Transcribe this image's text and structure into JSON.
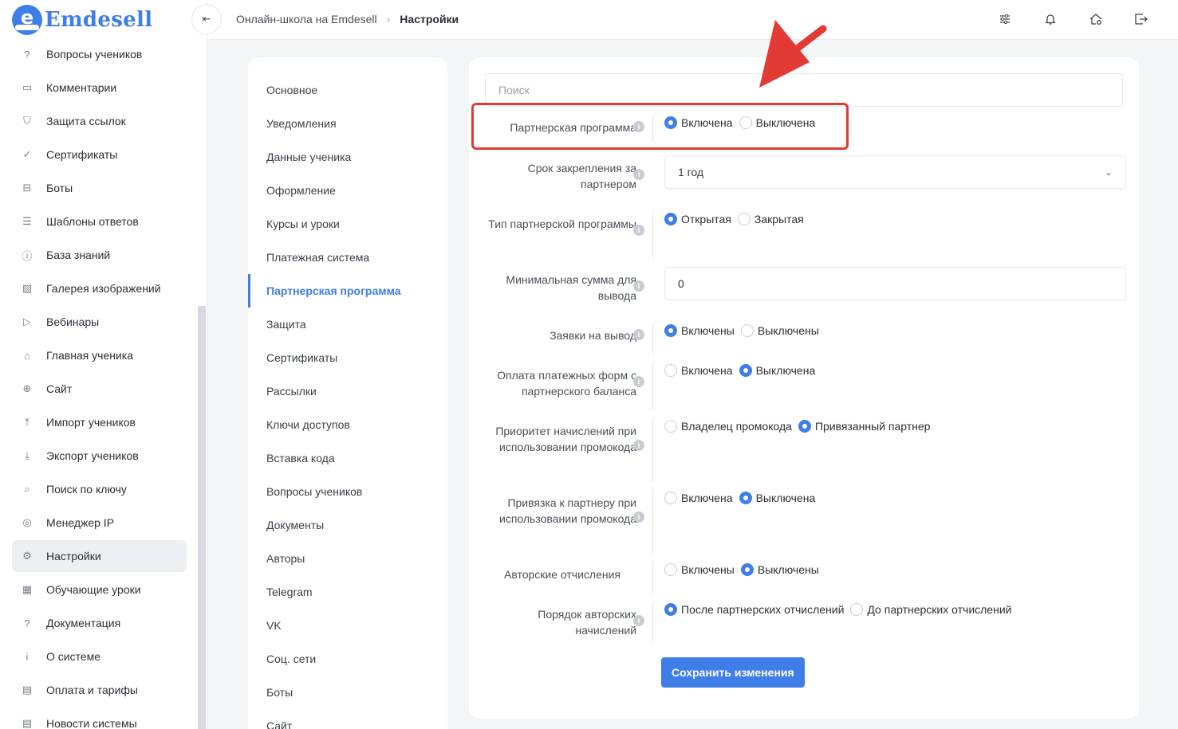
{
  "app": {
    "brand": "Emdesell",
    "accent_color": "#3f7ee8",
    "highlight_color": "#e23b36"
  },
  "sidebar": {
    "items": [
      {
        "label": "Вопросы учеников",
        "icon": "question-circle-icon",
        "glyph": "?"
      },
      {
        "label": "Комментарии",
        "icon": "comment-icon",
        "glyph": "▭"
      },
      {
        "label": "Защита ссылок",
        "icon": "shield-icon",
        "glyph": "⛉"
      },
      {
        "label": "Сертификаты",
        "icon": "certificate-icon",
        "glyph": "✓"
      },
      {
        "label": "Боты",
        "icon": "robot-icon",
        "glyph": "⊟"
      },
      {
        "label": "Шаблоны ответов",
        "icon": "list-icon",
        "glyph": "☰"
      },
      {
        "label": "База знаний",
        "icon": "info-circle-icon",
        "glyph": "ⓘ"
      },
      {
        "label": "Галерея изображений",
        "icon": "image-icon",
        "glyph": "▨"
      },
      {
        "label": "Вебинары",
        "icon": "play-icon",
        "glyph": "▷"
      },
      {
        "label": "Главная ученика",
        "icon": "home-icon",
        "glyph": "⌂"
      },
      {
        "label": "Сайт",
        "icon": "globe-icon",
        "glyph": "⊕"
      },
      {
        "label": "Импорт учеников",
        "icon": "upload-icon",
        "glyph": "⤒"
      },
      {
        "label": "Экспорт учеников",
        "icon": "download-icon",
        "glyph": "⤓"
      },
      {
        "label": "Поиск по ключу",
        "icon": "search-icon",
        "glyph": "⌕"
      },
      {
        "label": "Менеджер IP",
        "icon": "target-icon",
        "glyph": "◎"
      },
      {
        "label": "Настройки",
        "icon": "gear-icon",
        "glyph": "⚙",
        "active": true
      },
      {
        "label": "Обучающие уроки",
        "icon": "film-icon",
        "glyph": "▦"
      },
      {
        "label": "Документация",
        "icon": "question-square-icon",
        "glyph": "?"
      },
      {
        "label": "О системе",
        "icon": "info-square-icon",
        "glyph": "i"
      },
      {
        "label": "Оплата и тарифы",
        "icon": "receipt-icon",
        "glyph": "▤"
      },
      {
        "label": "Новости системы",
        "icon": "news-icon",
        "glyph": "▤"
      }
    ]
  },
  "topbar": {
    "breadcrumb": [
      "Онлайн-школа на Emdesell",
      "Настройки"
    ],
    "icons": [
      "sliders-icon",
      "bell-icon",
      "home-settings-icon",
      "logout-icon"
    ]
  },
  "settings_menu": {
    "items": [
      {
        "label": "Основное"
      },
      {
        "label": "Уведомления"
      },
      {
        "label": "Данные ученика"
      },
      {
        "label": "Оформление"
      },
      {
        "label": "Курсы и уроки"
      },
      {
        "label": "Платежная система"
      },
      {
        "label": "Партнерская программа",
        "active": true
      },
      {
        "label": "Защита"
      },
      {
        "label": "Сертификаты"
      },
      {
        "label": "Рассылки"
      },
      {
        "label": "Ключи доступов"
      },
      {
        "label": "Вставка кода"
      },
      {
        "label": "Вопросы учеников"
      },
      {
        "label": "Документы"
      },
      {
        "label": "Авторы"
      },
      {
        "label": "Telegram"
      },
      {
        "label": "VK"
      },
      {
        "label": "Соц. сети"
      },
      {
        "label": "Боты"
      },
      {
        "label": "Сайт"
      }
    ]
  },
  "form": {
    "search_placeholder": "Поиск",
    "affiliate_program": {
      "label": "Партнерская программа",
      "options": [
        "Включена",
        "Выключена"
      ],
      "selected": 0
    },
    "binding_period": {
      "label": "Срок закрепления за партнером",
      "value": "1 год"
    },
    "program_type": {
      "label": "Тип партнерской программы",
      "options": [
        "Открытая",
        "Закрытая"
      ],
      "selected": 0
    },
    "min_withdraw": {
      "label": "Минимальная сумма для вывода",
      "value": "0"
    },
    "withdraw_requests": {
      "label": "Заявки на вывод",
      "options": [
        "Включены",
        "Выключены"
      ],
      "selected": 0
    },
    "pay_from_balance": {
      "label": "Оплата платежных форм с партнерского баланса",
      "options": [
        "Включена",
        "Выключена"
      ],
      "selected": 1
    },
    "promo_priority": {
      "label": "Приоритет начислений при использовании промокода",
      "options": [
        "Владелец промокода",
        "Привязанный партнер"
      ],
      "selected": 1
    },
    "promo_binding": {
      "label": "Привязка к партнеру при использовании промокода",
      "options": [
        "Включена",
        "Выключена"
      ],
      "selected": 1
    },
    "author_fees": {
      "label": "Авторские отчисления",
      "options": [
        "Включены",
        "Выключены"
      ],
      "selected": 1
    },
    "author_fees_order": {
      "label": "Порядок авторских начислений",
      "options": [
        "После партнерских отчислений",
        "До партнерских отчислений"
      ],
      "selected": 0
    },
    "save_label": "Сохранить изменения"
  }
}
